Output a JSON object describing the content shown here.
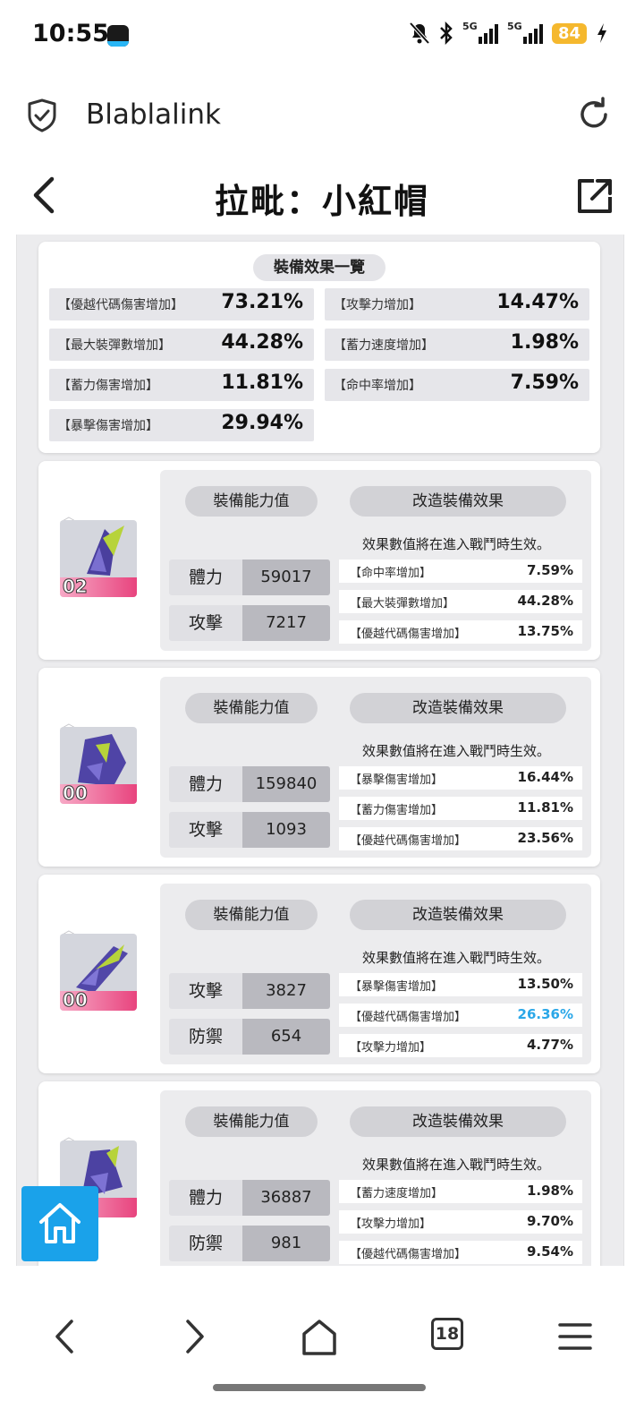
{
  "status_bar": {
    "time": "10:55",
    "signal_1": "5G",
    "signal_2": "5G",
    "battery": "84"
  },
  "browser": {
    "site_title": "Blablalink"
  },
  "header": {
    "title": "拉毗：小紅帽"
  },
  "summary": {
    "title": "裝備效果一覽",
    "items": [
      {
        "label": "【優越代碼傷害增加】",
        "value": "73.21%"
      },
      {
        "label": "【攻擊力增加】",
        "value": "14.47%"
      },
      {
        "label": "【最大裝彈數增加】",
        "value": "44.28%"
      },
      {
        "label": "【蓄力速度增加】",
        "value": "1.98%"
      },
      {
        "label": "【蓄力傷害增加】",
        "value": "11.81%"
      },
      {
        "label": "【命中率增加】",
        "value": "7.59%"
      },
      {
        "label": "【暴擊傷害增加】",
        "value": "29.94%"
      }
    ]
  },
  "labels": {
    "stats_header": "裝備能力值",
    "effects_header": "改造裝備效果",
    "effects_note": "效果數值將在進入戰鬥時生效。"
  },
  "equipment": [
    {
      "level": "02",
      "stats": [
        {
          "name": "體力",
          "value": "59017"
        },
        {
          "name": "攻擊",
          "value": "7217"
        }
      ],
      "effects": [
        {
          "label": "【命中率增加】",
          "value": "7.59%"
        },
        {
          "label": "【最大裝彈數增加】",
          "value": "44.28%"
        },
        {
          "label": "【優越代碼傷害增加】",
          "value": "13.75%"
        }
      ]
    },
    {
      "level": "00",
      "stats": [
        {
          "name": "體力",
          "value": "159840"
        },
        {
          "name": "攻擊",
          "value": "1093"
        }
      ],
      "effects": [
        {
          "label": "【暴擊傷害增加】",
          "value": "16.44%"
        },
        {
          "label": "【蓄力傷害增加】",
          "value": "11.81%"
        },
        {
          "label": "【優越代碼傷害增加】",
          "value": "23.56%"
        }
      ]
    },
    {
      "level": "00",
      "stats": [
        {
          "name": "攻擊",
          "value": "3827"
        },
        {
          "name": "防禦",
          "value": "654"
        }
      ],
      "effects": [
        {
          "label": "【暴擊傷害增加】",
          "value": "13.50%"
        },
        {
          "label": "【優越代碼傷害增加】",
          "value": "26.36%"
        },
        {
          "label": "【攻擊力增加】",
          "value": "4.77%"
        }
      ]
    },
    {
      "level": "",
      "stats": [
        {
          "name": "體力",
          "value": "36887"
        },
        {
          "name": "防禦",
          "value": "981"
        }
      ],
      "effects": [
        {
          "label": "【蓄力速度增加】",
          "value": "1.98%"
        },
        {
          "label": "【攻擊力增加】",
          "value": "9.70%"
        },
        {
          "label": "【優越代碼傷害增加】",
          "value": "9.54%"
        }
      ]
    }
  ],
  "bottom_nav": {
    "tab_count": "18"
  },
  "colors": {
    "highlight": "#2aa7e8",
    "home_button": "#1aa2ea",
    "level_bar": "#e8447e"
  },
  "icons": [
    "bell-muted-icon",
    "bluetooth-icon",
    "charging-icon",
    "shield-check-icon",
    "reload-icon",
    "back-icon",
    "share-icon",
    "home-icon",
    "nav-back-icon",
    "nav-forward-icon",
    "nav-home-icon",
    "menu-icon"
  ]
}
